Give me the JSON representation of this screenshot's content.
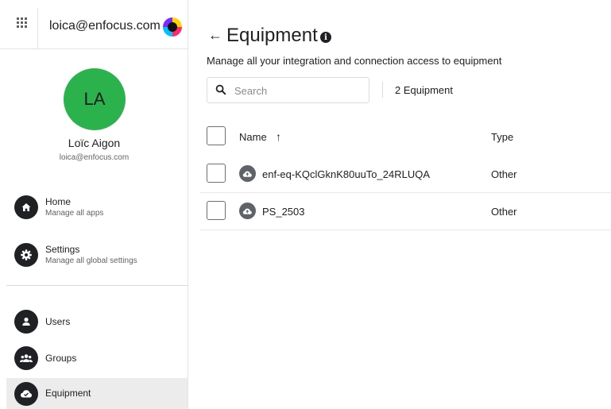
{
  "header": {
    "account_email": "loica@enfocus.com"
  },
  "profile": {
    "initials": "LA",
    "name": "Loïc Aigon",
    "email": "loica@enfocus.com",
    "avatar_color": "#2bb24c"
  },
  "nav": {
    "primary": [
      {
        "title": "Home",
        "subtitle": "Manage all apps",
        "icon": "home-icon"
      },
      {
        "title": "Settings",
        "subtitle": "Manage all global settings",
        "icon": "gear-icon"
      }
    ],
    "secondary": [
      {
        "title": "Users",
        "icon": "user-icon"
      },
      {
        "title": "Groups",
        "icon": "group-icon"
      },
      {
        "title": "Equipment",
        "icon": "equipment-icon",
        "active": true
      }
    ]
  },
  "page": {
    "title": "Equipment",
    "description": "Manage all your integration and connection access to equipment",
    "search_placeholder": "Search",
    "count_label": "2 Equipment"
  },
  "table": {
    "columns": [
      "Name",
      "Type"
    ],
    "sort": "ascending",
    "rows": [
      {
        "name": "enf-eq-KQclGknK80uuTo_24RLUQA",
        "type": "Other"
      },
      {
        "name": "PS_2503",
        "type": "Other"
      }
    ]
  },
  "colors": {
    "active_nav_bg": "#ececec",
    "icon_dark": "#202124"
  }
}
